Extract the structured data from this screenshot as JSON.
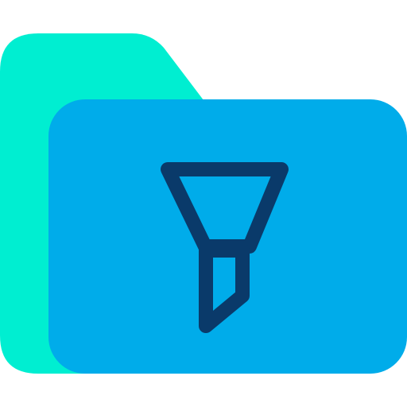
{
  "icon": {
    "name": "filter-folder-icon",
    "colors": {
      "folder_back": "#00EED1",
      "folder_front": "#00ACEA",
      "filter_stroke": "#0A3A6A"
    }
  }
}
